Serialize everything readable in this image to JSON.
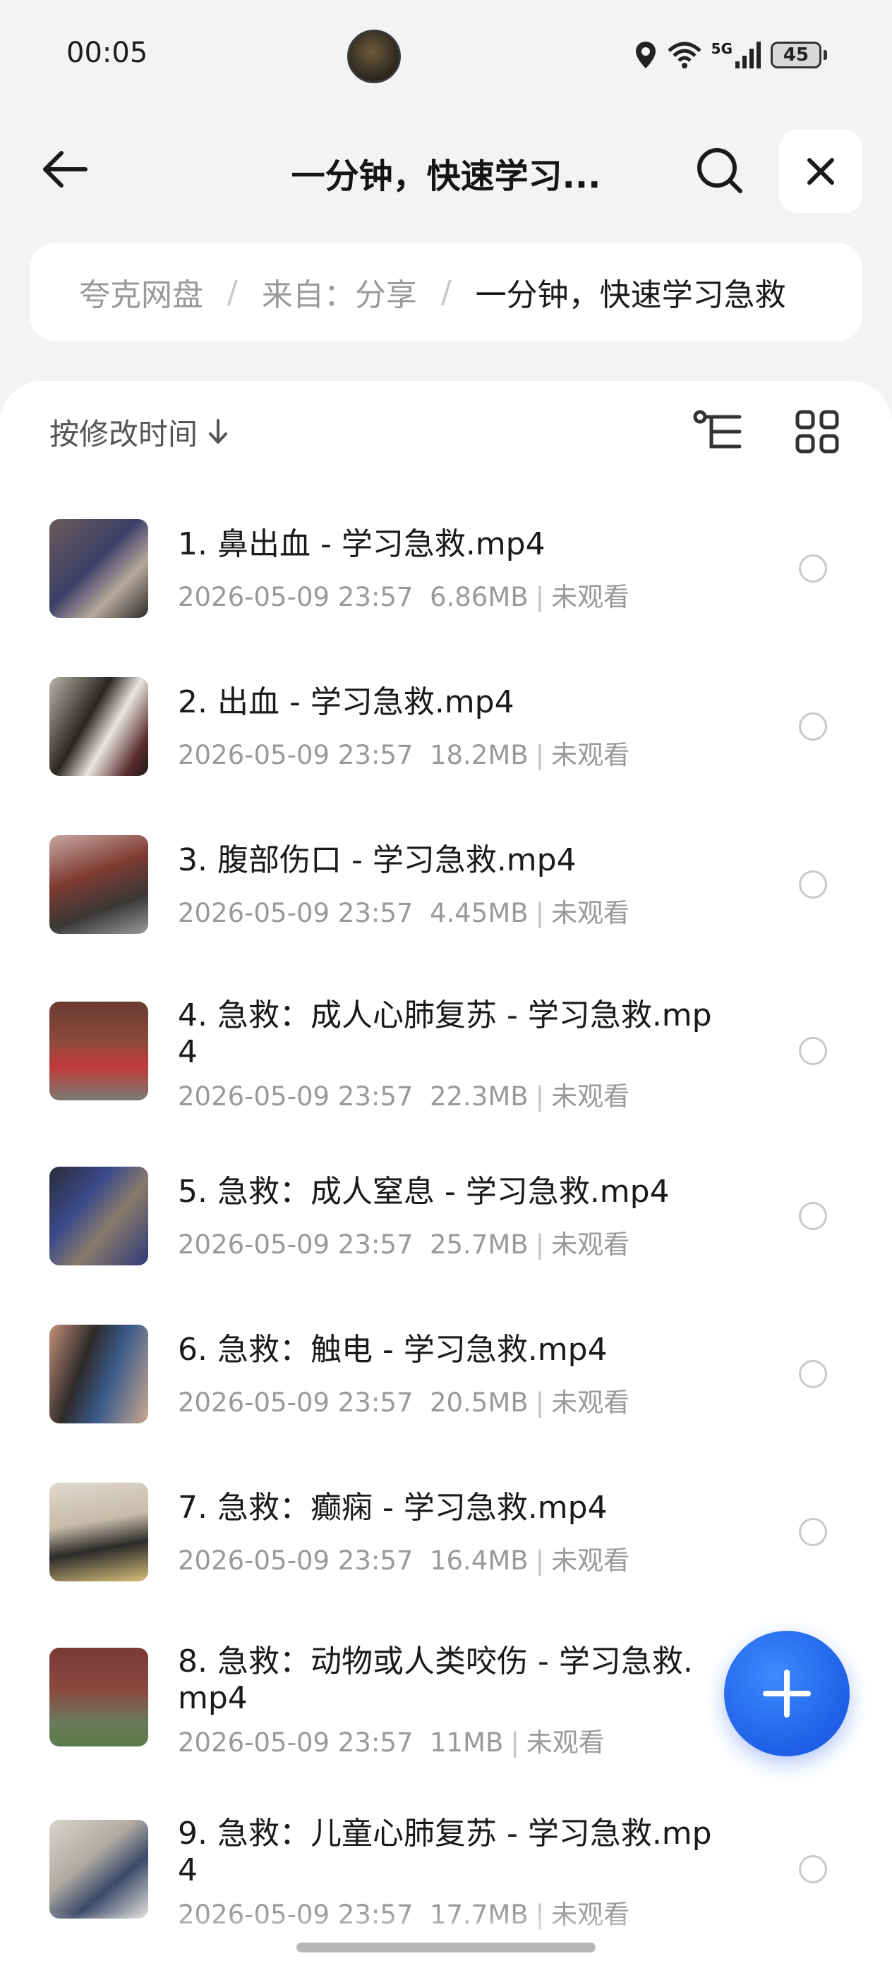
{
  "status_bar": {
    "time": "00:05",
    "network": "5G",
    "battery": "45"
  },
  "header": {
    "title": "一分钟，快速学习..."
  },
  "breadcrumb": {
    "items": [
      "夸克网盘",
      "来自：分享"
    ],
    "current": "一分钟，快速学习急救"
  },
  "toolbar": {
    "sort_label": "按修改时间"
  },
  "files": [
    {
      "name": "1. 鼻出血 - 学习急救.mp4",
      "date": "2026-05-09 23:57",
      "size": "6.86MB",
      "status": "未观看"
    },
    {
      "name": "2. 出血 - 学习急救.mp4",
      "date": "2026-05-09 23:57",
      "size": "18.2MB",
      "status": "未观看"
    },
    {
      "name": "3. 腹部伤口 - 学习急救.mp4",
      "date": "2026-05-09 23:57",
      "size": "4.45MB",
      "status": "未观看"
    },
    {
      "name": "4. 急救：成人心肺复苏 - 学习急救.mp4",
      "date": "2026-05-09 23:57",
      "size": "22.3MB",
      "status": "未观看"
    },
    {
      "name": "5. 急救：成人窒息 - 学习急救.mp4",
      "date": "2026-05-09 23:57",
      "size": "25.7MB",
      "status": "未观看"
    },
    {
      "name": "6. 急救：触电 - 学习急救.mp4",
      "date": "2026-05-09 23:57",
      "size": "20.5MB",
      "status": "未观看"
    },
    {
      "name": "7. 急救：癫痫 - 学习急救.mp4",
      "date": "2026-05-09 23:57",
      "size": "16.4MB",
      "status": "未观看"
    },
    {
      "name": "8. 急救：动物或人类咬伤 - 学习急救.mp4",
      "date": "2026-05-09 23:57",
      "size": "11MB",
      "status": "未观看"
    },
    {
      "name": "9. 急救：儿童心肺复苏 - 学习急救.mp4",
      "date": "2026-05-09 23:57",
      "size": "17.7MB",
      "status": "未观看"
    }
  ],
  "colors": {
    "accent": "#1e5fe6",
    "background": "#f2f3f5",
    "secondary_text": "#9a9a9a"
  },
  "icons": {
    "back": "arrow-left-icon",
    "search": "search-icon",
    "close": "close-icon",
    "sort_direction": "arrow-down-icon",
    "tree_view": "tree-view-icon",
    "grid_view": "grid-view-icon",
    "add": "plus-icon"
  }
}
